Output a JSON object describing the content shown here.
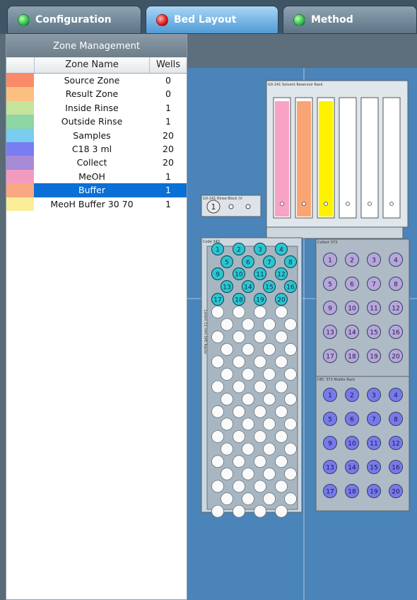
{
  "tabs": [
    {
      "label": "Configuration",
      "status": "green"
    },
    {
      "label": "Bed Layout",
      "status": "red"
    },
    {
      "label": "Method",
      "status": "green"
    }
  ],
  "zone_management": {
    "title": "Zone Management",
    "columns": {
      "name": "Zone Name",
      "wells": "Wells"
    },
    "rows": [
      {
        "name": "Source Zone",
        "wells": "0",
        "color": "#f98b6b"
      },
      {
        "name": "Result Zone",
        "wells": "0",
        "color": "#fbbf7f"
      },
      {
        "name": "Inside Rinse",
        "wells": "1",
        "color": "#c6e39c"
      },
      {
        "name": "Outside Rinse",
        "wells": "1",
        "color": "#8ed6a4"
      },
      {
        "name": "Samples",
        "wells": "20",
        "color": "#78cdf0"
      },
      {
        "name": "C18 3 ml",
        "wells": "20",
        "color": "#7a7cf2"
      },
      {
        "name": "Collect",
        "wells": "20",
        "color": "#a78ad6"
      },
      {
        "name": "MeOH",
        "wells": "1",
        "color": "#f39ac0"
      },
      {
        "name": "Buffer",
        "wells": "1",
        "color": "#f9a882",
        "selected": true
      },
      {
        "name": "MeoH Buffer 30 70",
        "wells": "1",
        "color": "#fbee98"
      }
    ]
  },
  "bed_layout": {
    "reservoir_rack": {
      "label": "GX-241 Solvent Reservoir Rack",
      "bottle_colors": [
        "#f8a2c4",
        "#f9a573",
        "#fff200",
        "#ffffff",
        "#ffffff",
        "#ffffff"
      ]
    },
    "rinse_block": {
      "label": "GX-241 Rinse Block (V",
      "well_label": "1"
    },
    "sample_rack": {
      "label": "Code 343",
      "side_label": "Lorem 12 mm SPE Racks",
      "numbered_wells": [
        "1",
        "2",
        "3",
        "4",
        "5",
        "6",
        "7",
        "8",
        "9",
        "10",
        "11",
        "12",
        "13",
        "14",
        "15",
        "16",
        "17",
        "18",
        "19",
        "20"
      ]
    },
    "collect_rack": {
      "label": "Collect 373",
      "wells": [
        "1",
        "2",
        "3",
        "4",
        "5",
        "6",
        "7",
        "8",
        "9",
        "10",
        "11",
        "12",
        "13",
        "14",
        "15",
        "16",
        "17",
        "18",
        "19",
        "20"
      ]
    },
    "mobile_rack": {
      "label": "DEC 373 Mobile Rack",
      "wells": [
        "1",
        "2",
        "3",
        "4",
        "5",
        "6",
        "7",
        "8",
        "9",
        "10",
        "11",
        "12",
        "13",
        "14",
        "15",
        "16",
        "17",
        "18",
        "19",
        "20"
      ]
    }
  }
}
